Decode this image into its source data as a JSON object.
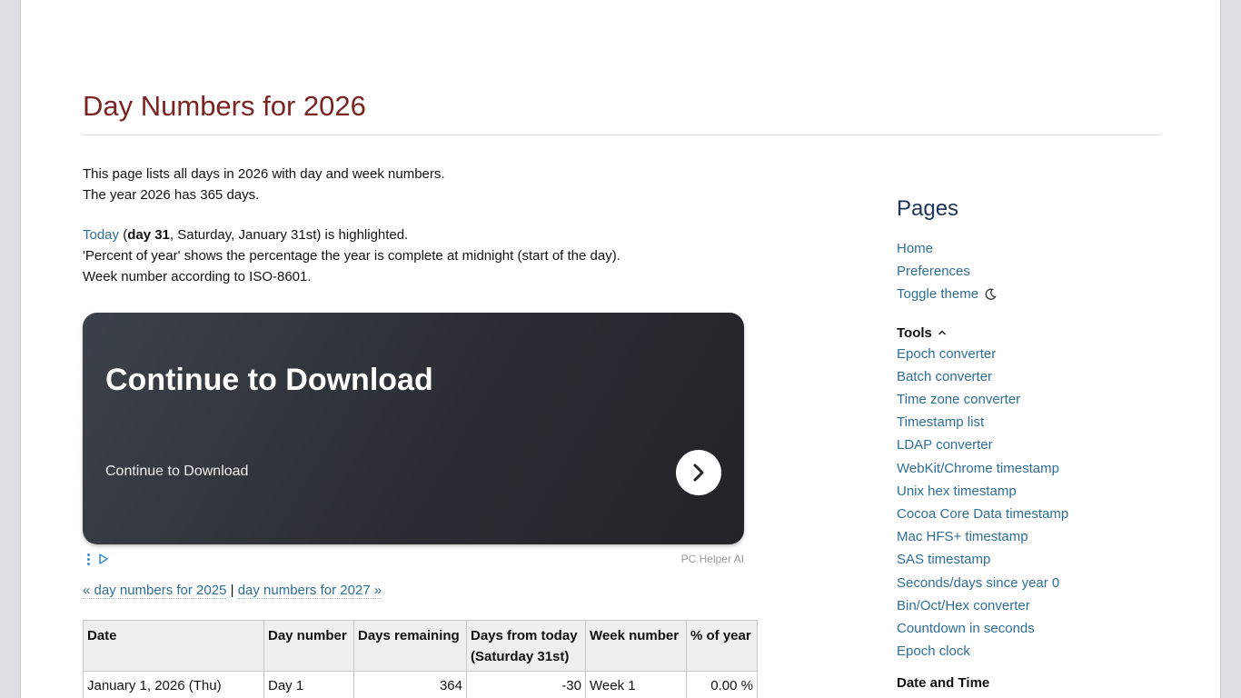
{
  "page": {
    "title": "Day Numbers for 2026",
    "intro_line1": "This page lists all days in 2026 with day and week numbers.",
    "intro_line2": "The year 2026 has 365 days.",
    "today_link": "Today",
    "today_paren_open": " (",
    "today_day": "day 31",
    "today_rest": ", Saturday, January 31st) is highlighted.",
    "percent_note": "'Percent of year' shows the percentage the year is complete at midnight (start of the day).",
    "week_note": "Week number according to ISO-8601."
  },
  "ad": {
    "headline": "Continue to Download",
    "subtext": "Continue to Download",
    "brand": "PC Helper AI",
    "bg_color": "#2a2d33"
  },
  "year_nav": {
    "prev": "« day numbers for 2025",
    "separator": "|",
    "next": "day numbers for 2027 »"
  },
  "table": {
    "headers": [
      "Date",
      "Day number",
      "Days remaining",
      "Days from today",
      "(Saturday 31st)",
      "Week number",
      "% of year"
    ],
    "rows": [
      {
        "date": "January 1, 2026 (Thu)",
        "day": "Day 1",
        "remaining": "364",
        "from_today": "-30",
        "week": "Week 1",
        "percent": "0.00 %"
      }
    ]
  },
  "sidebar": {
    "pages_heading": "Pages",
    "pages": [
      "Home",
      "Preferences",
      "Toggle theme"
    ],
    "tools_heading": "Tools",
    "tools": [
      "Epoch converter",
      "Batch converter",
      "Time zone converter",
      "Timestamp list",
      "LDAP converter",
      "WebKit/Chrome timestamp",
      "Unix hex timestamp",
      "Cocoa Core Data timestamp",
      "Mac HFS+ timestamp",
      "SAS timestamp",
      "Seconds/days since year 0",
      "Bin/Oct/Hex converter",
      "Countdown in seconds",
      "Epoch clock"
    ],
    "date_heading": "Date and Time"
  },
  "colors": {
    "title": "#7a2424",
    "link": "#2f6f96",
    "sidebar_heading": "#1d3557"
  }
}
